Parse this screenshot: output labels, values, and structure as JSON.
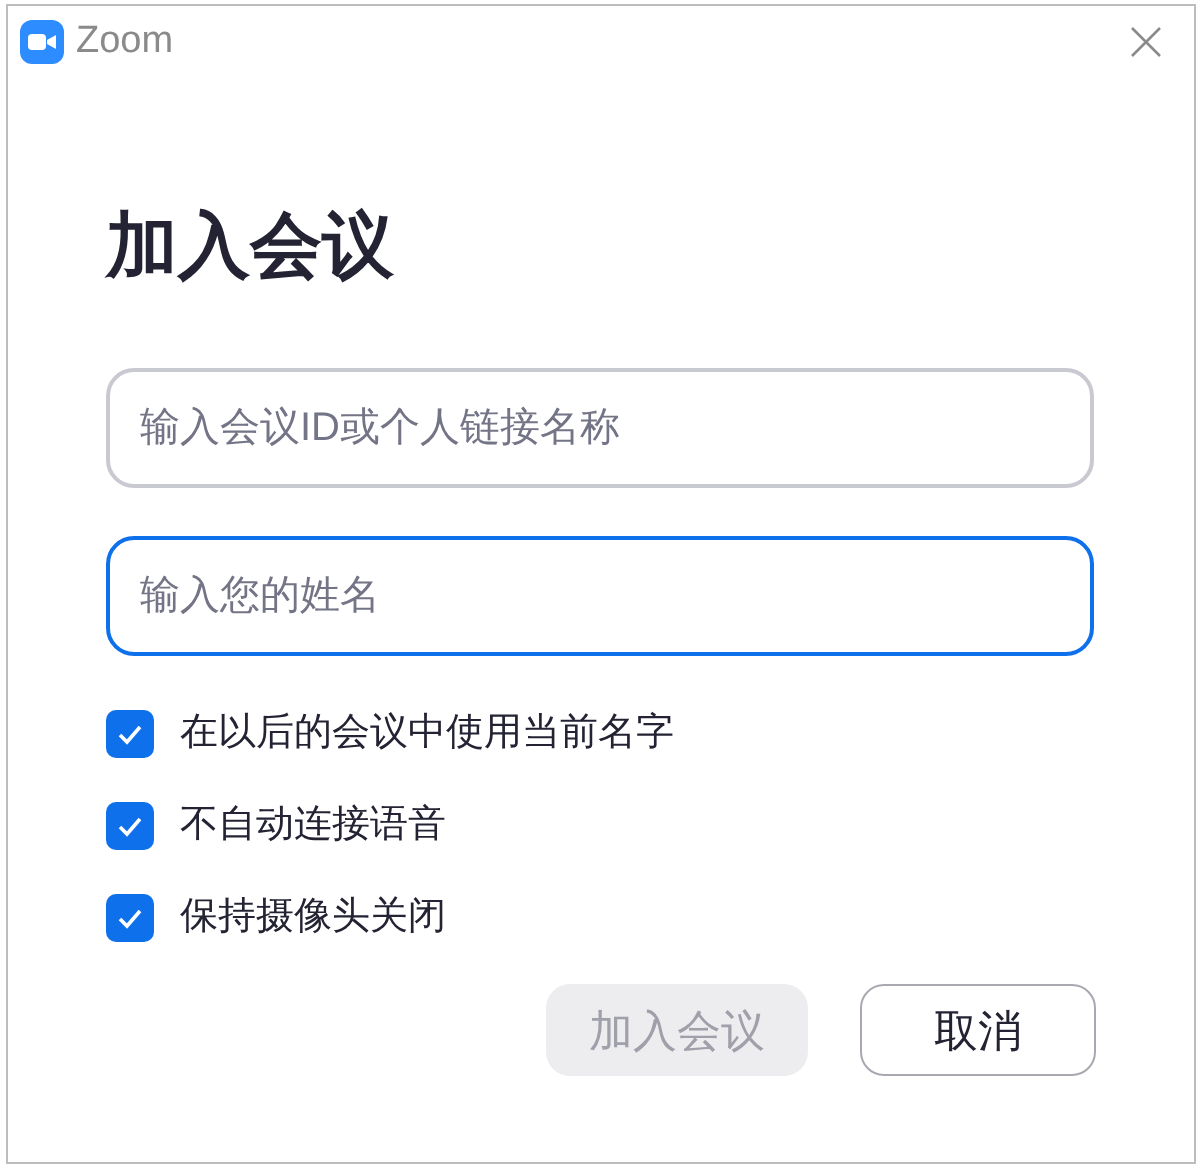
{
  "window": {
    "title": "Zoom"
  },
  "heading": "加入会议",
  "fields": [
    {
      "placeholder": "输入会议ID或个人链接名称",
      "focused": false
    },
    {
      "placeholder": "输入您的姓名",
      "focused": true
    }
  ],
  "options": [
    {
      "label": "在以后的会议中使用当前名字",
      "checked": true
    },
    {
      "label": "不自动连接语音",
      "checked": true
    },
    {
      "label": "保持摄像头关闭",
      "checked": true
    }
  ],
  "buttons": [
    {
      "label": "加入会议",
      "kind": "primary",
      "disabled": true
    },
    {
      "label": "取消",
      "kind": "secondary",
      "disabled": false
    }
  ]
}
